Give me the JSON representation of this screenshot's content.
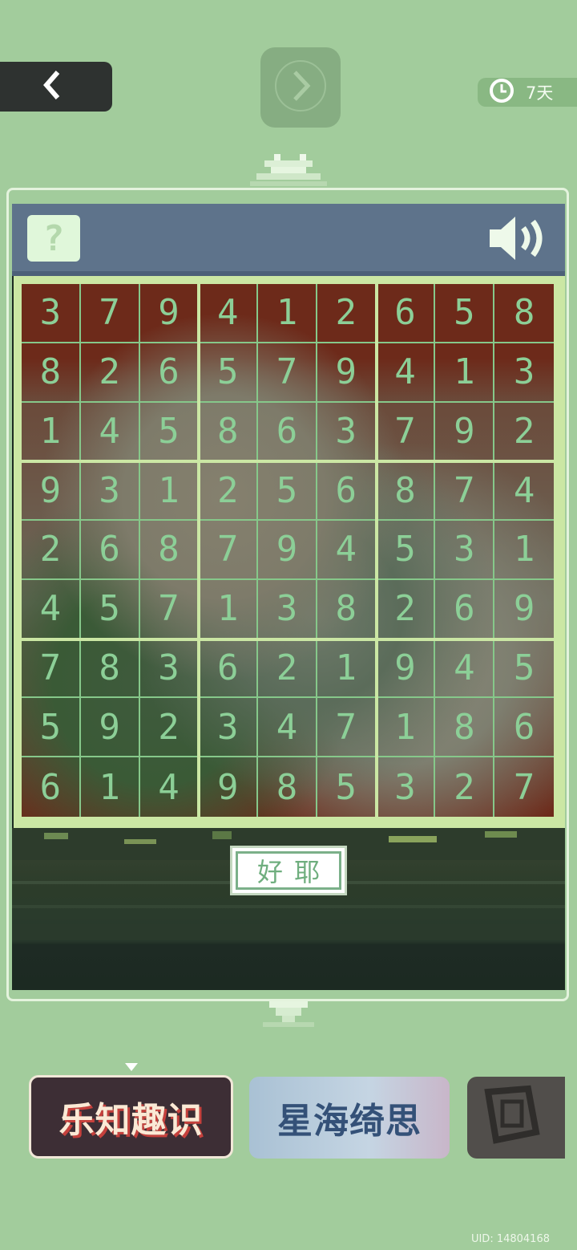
{
  "nav": {
    "back_icon": "chevron-left-icon",
    "next_icon": "chevron-right-circle-icon"
  },
  "timer": {
    "icon": "clock-icon",
    "text": "7天"
  },
  "header": {
    "help_label": "?",
    "sound_icon": "speaker-icon"
  },
  "sudoku": {
    "rows": [
      [
        "3",
        "7",
        "9",
        "4",
        "1",
        "2",
        "6",
        "5",
        "8"
      ],
      [
        "8",
        "2",
        "6",
        "5",
        "7",
        "9",
        "4",
        "1",
        "3"
      ],
      [
        "1",
        "4",
        "5",
        "8",
        "6",
        "3",
        "7",
        "9",
        "2"
      ],
      [
        "9",
        "3",
        "1",
        "2",
        "5",
        "6",
        "8",
        "7",
        "4"
      ],
      [
        "2",
        "6",
        "8",
        "7",
        "9",
        "4",
        "5",
        "3",
        "1"
      ],
      [
        "4",
        "5",
        "7",
        "1",
        "3",
        "8",
        "2",
        "6",
        "9"
      ],
      [
        "7",
        "8",
        "3",
        "6",
        "2",
        "1",
        "9",
        "4",
        "5"
      ],
      [
        "5",
        "9",
        "2",
        "3",
        "4",
        "7",
        "1",
        "8",
        "6"
      ],
      [
        "6",
        "1",
        "4",
        "9",
        "8",
        "5",
        "3",
        "2",
        "7"
      ]
    ]
  },
  "confirm_button": {
    "label": "好耶"
  },
  "banners": [
    {
      "title": "乐知趣识",
      "selected": true
    },
    {
      "title": "星海绮思",
      "selected": false
    },
    {
      "title": "",
      "selected": false
    }
  ],
  "uid": "UID: 14804168",
  "colors": {
    "background": "#a2cc9c",
    "digit": "#8ccf97",
    "header": "#5e738b",
    "grid": "#cbe7a4"
  }
}
